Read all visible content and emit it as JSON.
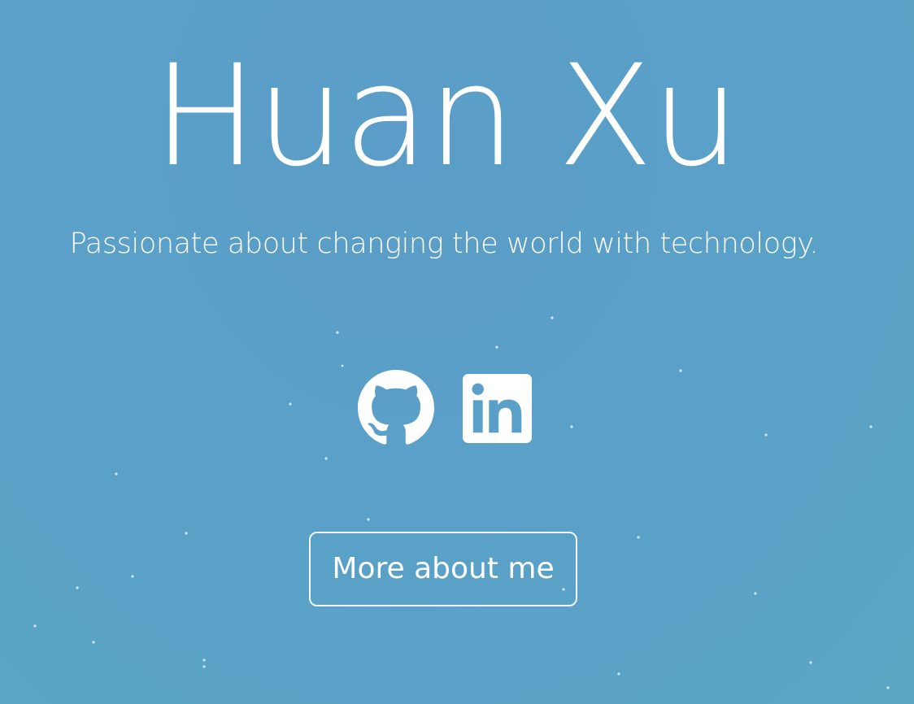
{
  "hero": {
    "name": "Huan Xu",
    "tagline": "Passionate about changing the world with technology."
  },
  "social": {
    "github_icon": "github-icon",
    "linkedin_icon": "linkedin-icon"
  },
  "cta": {
    "label": "More about me"
  },
  "colors": {
    "background": "#5aa0c8",
    "foreground": "#ffffff"
  }
}
